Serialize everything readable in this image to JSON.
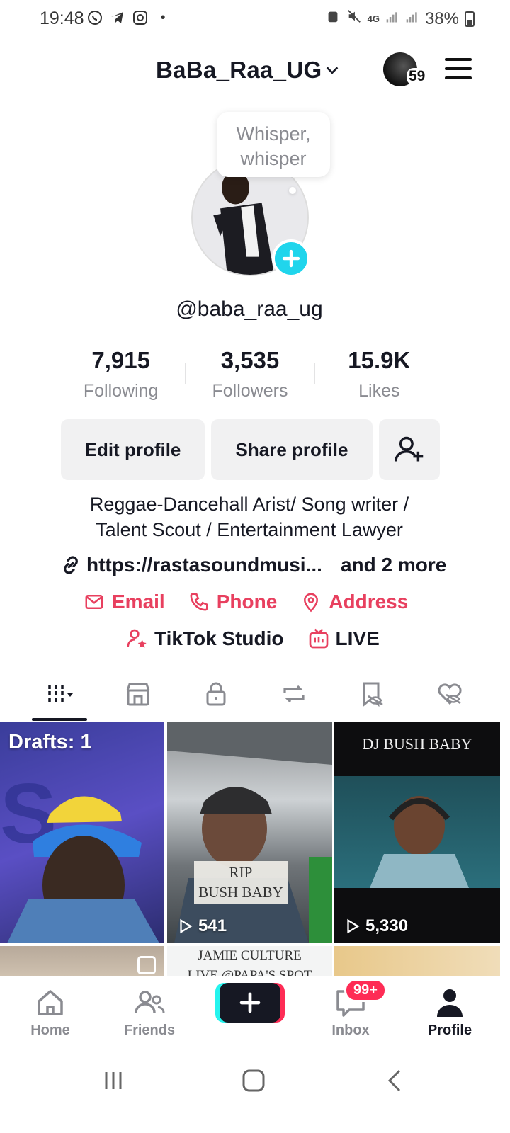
{
  "status_bar": {
    "time": "19:48",
    "network": "4G",
    "battery": "38%",
    "icons_left": [
      "whatsapp-icon",
      "telegram-icon",
      "instagram-icon",
      "dot-icon"
    ],
    "icons_right": [
      "alarm-icon",
      "mute-icon",
      "signal-icon",
      "signal-icon",
      "battery-icon"
    ]
  },
  "header": {
    "title": "BaBa_Raa_UG",
    "avatar_badge": "59"
  },
  "profile": {
    "note_bubble": "Whisper, whisper",
    "handle": "@baba_raa_ug",
    "stats": [
      {
        "value": "7,915",
        "label": "Following"
      },
      {
        "value": "3,535",
        "label": "Followers"
      },
      {
        "value": "15.9K",
        "label": "Likes"
      }
    ],
    "edit_label": "Edit profile",
    "share_label": "Share profile",
    "bio_line1": "Reggae-Dancehall Arist/ Song writer /",
    "bio_line2": "Talent Scout / Entertainment Lawyer",
    "link": "https://rastasoundmusi...",
    "link_more": "and 2 more",
    "contacts": [
      "Email",
      "Phone",
      "Address"
    ],
    "studio_label": "TikTok Studio",
    "live_label": "LIVE"
  },
  "tabs": [
    "videos-grid-icon",
    "shop-icon",
    "lock-icon",
    "repost-icon",
    "favorites-hidden-icon",
    "liked-hidden-icon"
  ],
  "grid": {
    "drafts": "Drafts: 1",
    "tile2_views": "541",
    "tile2_caption1": "RIP",
    "tile2_caption2": "BUSH BABY",
    "tile3_title": "DJ BUSH BABY",
    "tile3_views": "5,330",
    "tile5_line1": "JAMIE CULTURE",
    "tile5_line2": "LIVE @PAPA'S SPOT"
  },
  "bottom_nav": {
    "home": "Home",
    "friends": "Friends",
    "inbox": "Inbox",
    "inbox_badge": "99+",
    "profile": "Profile"
  },
  "colors": {
    "accent_red": "#e8405f",
    "cyan": "#20d5ec",
    "badge": "#fe2c55",
    "text": "#161823",
    "muted": "#8a8b91"
  }
}
